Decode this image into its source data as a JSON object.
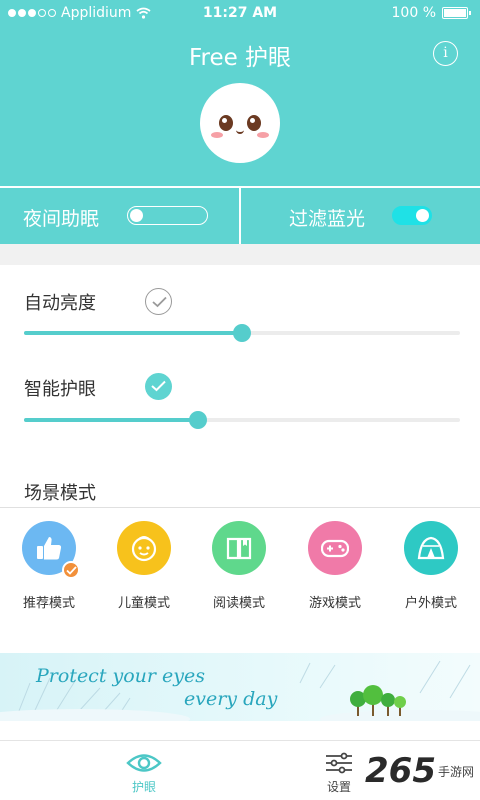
{
  "status_bar": {
    "carrier": "Applidium",
    "time": "11:27 AM",
    "battery_percent": 100,
    "battery_text": "100 %"
  },
  "header": {
    "title": "Free 护眼",
    "info_icon": "info-icon",
    "info_glyph": "i"
  },
  "toggles": {
    "night_sleep": {
      "label": "夜间助眠",
      "enabled": false
    },
    "blue_filter": {
      "label": "过滤蓝光",
      "enabled": true
    }
  },
  "settings": {
    "auto_brightness": {
      "label": "自动亮度",
      "checked": false,
      "slider_value": 0.5
    },
    "smart_protect": {
      "label": "智能护眼",
      "checked": true,
      "slider_value": 0.4
    }
  },
  "scene_section": {
    "title": "场景模式",
    "modes": [
      {
        "label": "推荐模式",
        "icon": "thumbs-up-icon",
        "color": "#6cb8f2",
        "selected": true
      },
      {
        "label": "儿童模式",
        "icon": "child-face-icon",
        "color": "#f7c21c",
        "selected": false
      },
      {
        "label": "阅读模式",
        "icon": "book-icon",
        "color": "#5fd88c",
        "selected": false
      },
      {
        "label": "游戏模式",
        "icon": "gamepad-icon",
        "color": "#f07aa8",
        "selected": false
      },
      {
        "label": "户外模式",
        "icon": "tent-icon",
        "color": "#2ec9c4",
        "selected": false
      }
    ]
  },
  "banner": {
    "line1": "Protect your eyes",
    "line2": "every day"
  },
  "bottom_nav": {
    "items": [
      {
        "label": "护眼",
        "icon": "eye-icon",
        "active": true
      },
      {
        "label": "设置",
        "icon": "settings-icon",
        "active": false
      }
    ]
  },
  "watermark": {
    "number": "265",
    "text": "手游网"
  },
  "colors": {
    "accent": "#5fd4d1",
    "slider": "#55cdcc",
    "toggle_on": "#1fe1e6"
  }
}
